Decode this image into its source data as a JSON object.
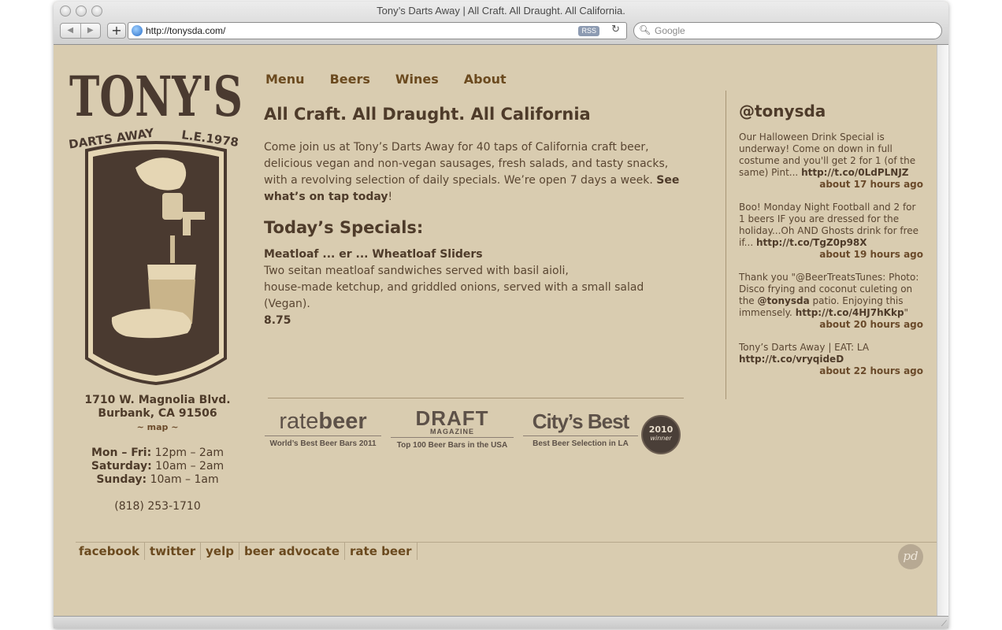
{
  "browser": {
    "window_title": "Tony’s Darts Away | All Craft. All Draught. All California.",
    "url": "http://tonysda.com/",
    "rss_label": "RSS",
    "search_placeholder": "Google"
  },
  "logo": {
    "name": "TONY'S",
    "tagline_left": "DARTS AWAY",
    "tagline_right": "L.E.1978"
  },
  "sidebar": {
    "address_line1": "1710 W. Magnolia Blvd.",
    "address_line2": "Burbank, CA 91506",
    "map_link": "~ map ~",
    "hours": [
      {
        "day": "Mon – Fri:",
        "time": "12pm – 2am"
      },
      {
        "day": "Saturday:",
        "time": "10am – 2am"
      },
      {
        "day": "Sunday:",
        "time": "10am – 1am"
      }
    ],
    "phone": "(818) 253-1710"
  },
  "nav": [
    "Menu",
    "Beers",
    "Wines",
    "About"
  ],
  "main": {
    "headline": "All Craft. All Draught. All California",
    "intro": "Come join us at Tony’s Darts Away for 40 taps of California craft beer, delicious vegan and non-vegan sausages, fresh salads, and tasty snacks, with a revolving selection of daily specials. We’re open 7 days a week.",
    "tap_link": "See what’s on tap today",
    "tap_suffix": "!",
    "specials_heading": "Today’s Specials:",
    "special_name": "Meatloaf ... er ... Wheatloaf Sliders",
    "special_desc_1": "Two seitan meatloaf sandwiches served with basil aioli,",
    "special_desc_2": "house-made ketchup, and griddled onions, served with a small salad (Vegan).",
    "special_price": "8.75"
  },
  "awards": [
    {
      "logo_a": "rate",
      "logo_b": "beer",
      "caption": "World’s Best Beer Bars 2011"
    },
    {
      "logo_a": "DRAFT",
      "logo_b": "MAGAZINE",
      "caption": "Top 100 Beer Bars in the USA"
    },
    {
      "logo_a": "City’s Best",
      "caption": "Best Beer Selection in LA",
      "badge_year": "2010",
      "badge_sub": "winner"
    }
  ],
  "twitter": {
    "handle": "@tonysda",
    "tweets": [
      {
        "text": "Our Halloween Drink Special is underway! Come on down in full costume and you'll get 2 for 1 (of the same) Pint... ",
        "link": "http://t.co/0LdPLNJZ",
        "time": "about 17 hours ago"
      },
      {
        "text": "Boo! Monday Night Football and 2 for 1 beers IF you are dressed for the holiday...Oh AND Ghosts drink for free if... ",
        "link": "http://t.co/TgZ0p98X",
        "time": "about 19 hours ago"
      },
      {
        "text": "Thank you \"@BeerTreatsTunes: Photo: Disco frying and coconut culeting on the ",
        "mention": "@tonysda",
        "text2": " patio. Enjoying this immensely. ",
        "link": "http://t.co/4HJ7hKkp",
        "link_suffix": "\"",
        "time": "about 20 hours ago"
      },
      {
        "text": "Tony’s Darts Away | EAT: LA ",
        "link": "http://t.co/vryqideD",
        "time": "about 22 hours ago"
      }
    ]
  },
  "footer": {
    "links": [
      "facebook",
      "twitter",
      "yelp",
      "beer advocate",
      "rate beer"
    ],
    "pd_mark": "pd"
  },
  "colors": {
    "page_bg": "#d9ccb0",
    "text_brown": "#4e3b2a",
    "link_brown": "#6b4a1f"
  }
}
